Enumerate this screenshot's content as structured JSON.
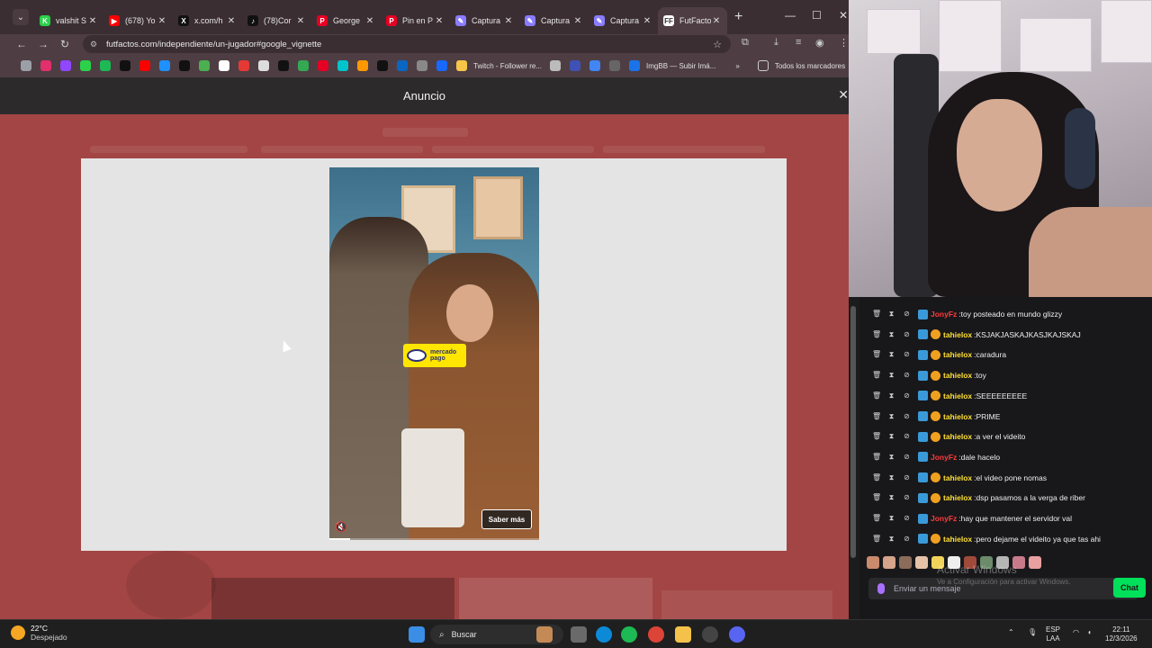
{
  "browser": {
    "tabs": [
      {
        "title": "valshit S",
        "color": "#2bd14a",
        "glyph": "K"
      },
      {
        "title": "(678) Yo",
        "color": "#ff0000",
        "glyph": "▶"
      },
      {
        "title": "x.com/h",
        "color": "#111111",
        "glyph": "X"
      },
      {
        "title": "(78)Cor",
        "color": "#111111",
        "glyph": "♪"
      },
      {
        "title": "George",
        "color": "#e60023",
        "glyph": "P"
      },
      {
        "title": "Pin en P",
        "color": "#e60023",
        "glyph": "P"
      },
      {
        "title": "Captura",
        "color": "#8a7cff",
        "glyph": "✎"
      },
      {
        "title": "Captura",
        "color": "#8a7cff",
        "glyph": "✎"
      },
      {
        "title": "Captura",
        "color": "#8a7cff",
        "glyph": "✎"
      },
      {
        "title": "FutFacto",
        "color": "#ffffff",
        "glyph": "FF"
      }
    ],
    "url": "futfactos.com/independiente/un-jugador#google_vignette",
    "bookmarks": {
      "twitch_follower": "Twitch - Follower re...",
      "imgbb": "ImgBB — Subir Imá...",
      "all_bookmarks": "Todos los marcadores"
    }
  },
  "ad": {
    "header_title": "Anuncio",
    "close_glyph": "✕",
    "brand_line1": "mercado",
    "brand_line2": "pago",
    "cta": "Saber más",
    "mute_glyph": "🔇",
    "progress": 0.1
  },
  "chat": {
    "messages": [
      {
        "user": "JonyFz",
        "color": "#ff3b3b",
        "badge": "box",
        "text": "toy posteado en mundo glizzy"
      },
      {
        "user": "tahielox",
        "color": "#ffe033",
        "badge": "coin",
        "text": "KSJAKJASKAJKASJKAJSKAJ"
      },
      {
        "user": "tahielox",
        "color": "#ffe033",
        "badge": "coin",
        "text": "caradura"
      },
      {
        "user": "tahielox",
        "color": "#ffe033",
        "badge": "coin",
        "text": "toy"
      },
      {
        "user": "tahielox",
        "color": "#ffe033",
        "badge": "coin",
        "text": "SEEEEEEEEE"
      },
      {
        "user": "tahielox",
        "color": "#ffe033",
        "badge": "coin",
        "text": "PRIME"
      },
      {
        "user": "tahielox",
        "color": "#ffe033",
        "badge": "coin",
        "text": "a ver el videito"
      },
      {
        "user": "JonyFz",
        "color": "#ff3b3b",
        "badge": "box",
        "text": "dale hacelo"
      },
      {
        "user": "tahielox",
        "color": "#ffe033",
        "badge": "coin",
        "text": "el video pone nomas"
      },
      {
        "user": "tahielox",
        "color": "#ffe033",
        "badge": "coin",
        "text": "dsp pasamos a la verga de riber"
      },
      {
        "user": "JonyFz",
        "color": "#ff3b3b",
        "badge": "box",
        "text": "hay que mantener el servidor val"
      },
      {
        "user": "tahielox",
        "color": "#ffe033",
        "badge": "coin",
        "text": "pero dejame el videito ya que tas ahi"
      }
    ],
    "input_placeholder": "Enviar un mensaje",
    "send_label": "Chat",
    "watermark": "Activar Windows",
    "watermark_sub": "Ve a Configuración para activar Windows."
  },
  "taskbar": {
    "temp": "22°C",
    "condition": "Despejado",
    "search_label": "Buscar",
    "lang_top": "ESP",
    "lang_bottom": "LAA",
    "time": "22:11",
    "date": "12/3/2026"
  }
}
